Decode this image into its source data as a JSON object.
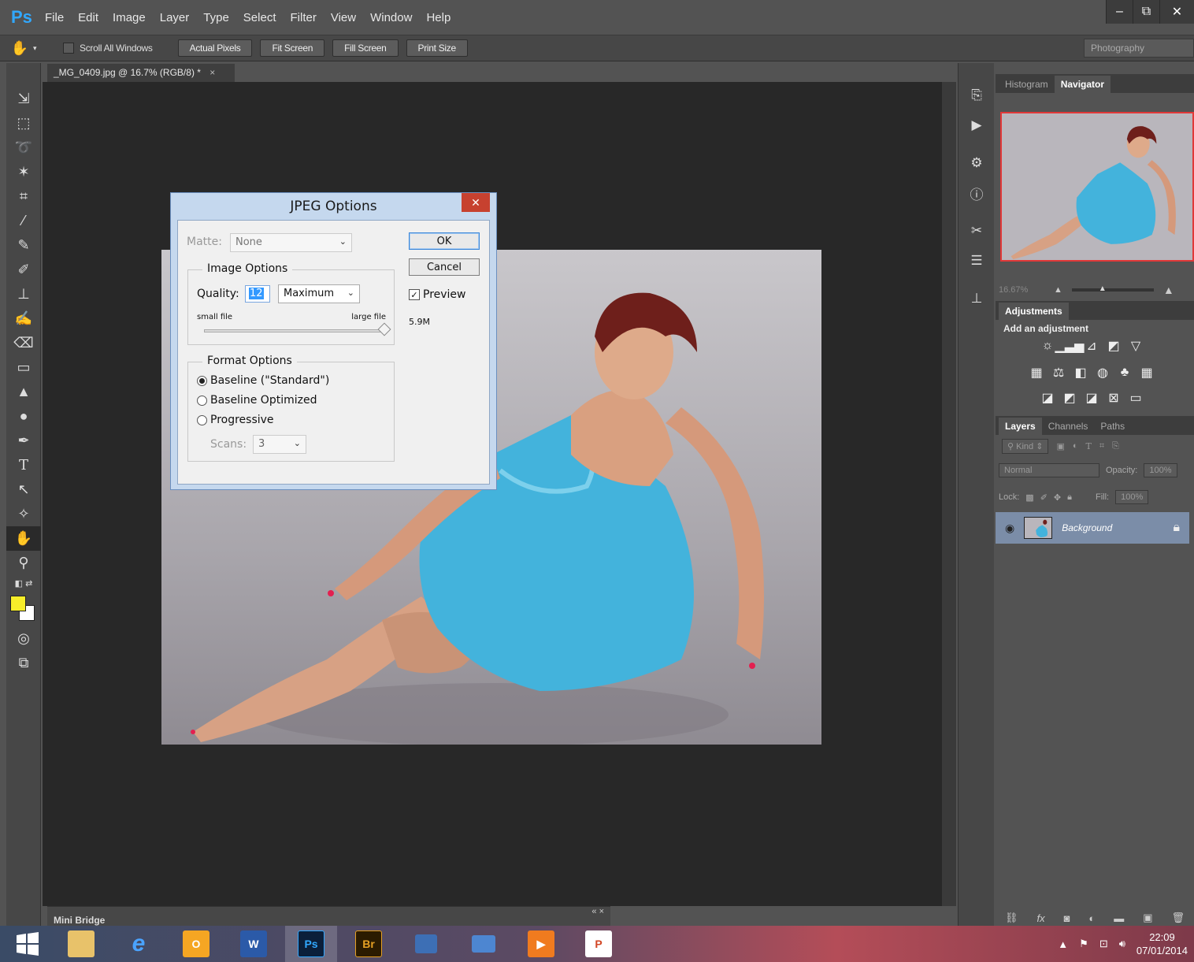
{
  "app": {
    "logo": "Ps"
  },
  "menu": [
    "File",
    "Edit",
    "Image",
    "Layer",
    "Type",
    "Select",
    "Filter",
    "View",
    "Window",
    "Help"
  ],
  "window_controls": {
    "minimize": "–",
    "restore": "⧉",
    "close": "✕"
  },
  "options_bar": {
    "scroll_all_windows": "Scroll All Windows",
    "buttons": [
      "Actual Pixels",
      "Fit Screen",
      "Fill Screen",
      "Print Size"
    ],
    "workspace": "Photography"
  },
  "document": {
    "tab_title": "_MG_0409.jpg @ 16.7% (RGB/8) *",
    "tab_close": "×"
  },
  "mini_bridge": {
    "label": "Mini Bridge",
    "controls": "«  ×"
  },
  "colors": {
    "foreground": "#f7ee2a",
    "background": "#ffffff",
    "dialog_close": "#c7412f"
  },
  "navigator": {
    "tabs": [
      "Histogram",
      "Navigator"
    ],
    "zoom": "16.67%"
  },
  "adjustments": {
    "tab": "Adjustments",
    "title": "Add an adjustment"
  },
  "layers": {
    "tabs": [
      "Layers",
      "Channels",
      "Paths"
    ],
    "filter_kind": "Kind",
    "blend_mode": "Normal",
    "opacity_label": "Opacity:",
    "opacity_value": "100%",
    "lock_label": "Lock:",
    "fill_label": "Fill:",
    "fill_value": "100%",
    "layer_name": "Background"
  },
  "jpeg_dialog": {
    "title": "JPEG Options",
    "close": "✕",
    "matte_label": "Matte:",
    "matte_value": "None",
    "image_options_legend": "Image Options",
    "quality_label": "Quality:",
    "quality_value": "12",
    "quality_preset": "Maximum",
    "small_file": "small file",
    "large_file": "large file",
    "quality_fraction": 1.0,
    "format_options_legend": "Format Options",
    "format_options": [
      "Baseline (\"Standard\")",
      "Baseline Optimized",
      "Progressive"
    ],
    "selected_format": 0,
    "scans_label": "Scans:",
    "scans_value": "3",
    "ok": "OK",
    "cancel": "Cancel",
    "preview_label": "Preview",
    "preview_checked": true,
    "file_size": "5.9M"
  },
  "taskbar": {
    "apps": [
      "file-explorer",
      "internet-explorer",
      "outlook",
      "word",
      "photoshop",
      "bridge",
      "network",
      "explorer-window",
      "media",
      "powerpoint"
    ],
    "clock_time": "22:09",
    "clock_date": "07/01/2014"
  }
}
